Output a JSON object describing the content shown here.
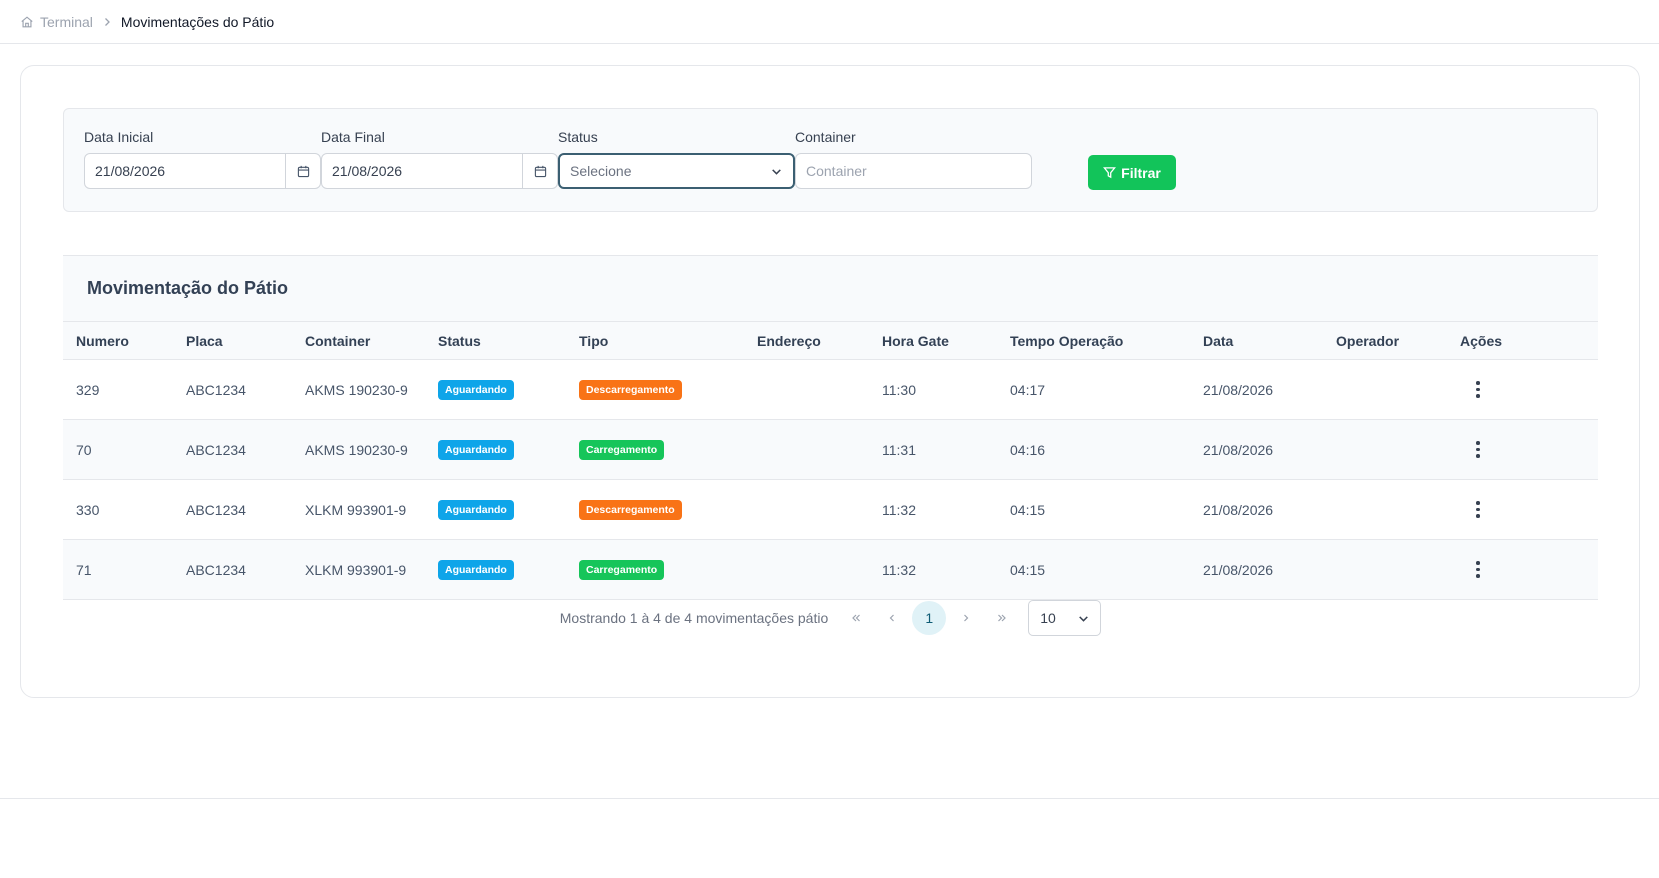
{
  "breadcrumb": {
    "root": "Terminal",
    "current": "Movimentações do Pátio"
  },
  "filters": {
    "start_date_label": "Data Inicial",
    "start_date_value": "21/08/2026",
    "end_date_label": "Data Final",
    "end_date_value": "21/08/2026",
    "status_label": "Status",
    "status_value": "Selecione",
    "container_label": "Container",
    "container_placeholder": "Container",
    "filter_button": "Filtrar"
  },
  "table": {
    "title": "Movimentação do Pátio",
    "columns": [
      "Numero",
      "Placa",
      "Container",
      "Status",
      "Tipo",
      "Endereço",
      "Hora Gate",
      "Tempo Operação",
      "Data",
      "Operador",
      "Ações"
    ],
    "rows": [
      {
        "numero": "329",
        "placa": "ABC1234",
        "container": "AKMS 190230-9",
        "status": "Aguardando",
        "tipo": "Descarregamento",
        "endereco": "",
        "hora_gate": "11:30",
        "tempo_operacao": "04:17",
        "data": "21/08/2026",
        "operador": ""
      },
      {
        "numero": "70",
        "placa": "ABC1234",
        "container": "AKMS 190230-9",
        "status": "Aguardando",
        "tipo": "Carregamento",
        "endereco": "",
        "hora_gate": "11:31",
        "tempo_operacao": "04:16",
        "data": "21/08/2026",
        "operador": ""
      },
      {
        "numero": "330",
        "placa": "ABC1234",
        "container": "XLKM 993901-9",
        "status": "Aguardando",
        "tipo": "Descarregamento",
        "endereco": "",
        "hora_gate": "11:32",
        "tempo_operacao": "04:15",
        "data": "21/08/2026",
        "operador": ""
      },
      {
        "numero": "71",
        "placa": "ABC1234",
        "container": "XLKM 993901-9",
        "status": "Aguardando",
        "tipo": "Carregamento",
        "endereco": "",
        "hora_gate": "11:32",
        "tempo_operacao": "04:15",
        "data": "21/08/2026",
        "operador": ""
      }
    ]
  },
  "pagination": {
    "summary": "Mostrando 1 à 4 de 4 movimentações pátio",
    "current_page": "1",
    "rows_per_page": "10"
  },
  "colors": {
    "status_aguardando": "#0ea5e9",
    "tipo_descarregamento": "#f97316",
    "tipo_carregamento": "#16c55a",
    "filter_button": "#12c45a"
  },
  "icons": {
    "home": "home-icon",
    "breadcrumb_separator": "chevron-right-icon",
    "calendar": "calendar-icon",
    "dropdown": "chevron-down-icon",
    "filter": "filter-icon",
    "row_actions": "kebab-menu-icon",
    "first_page": "double-chevron-left-icon",
    "prev_page": "chevron-left-icon",
    "next_page": "chevron-right-icon",
    "last_page": "double-chevron-right-icon"
  }
}
